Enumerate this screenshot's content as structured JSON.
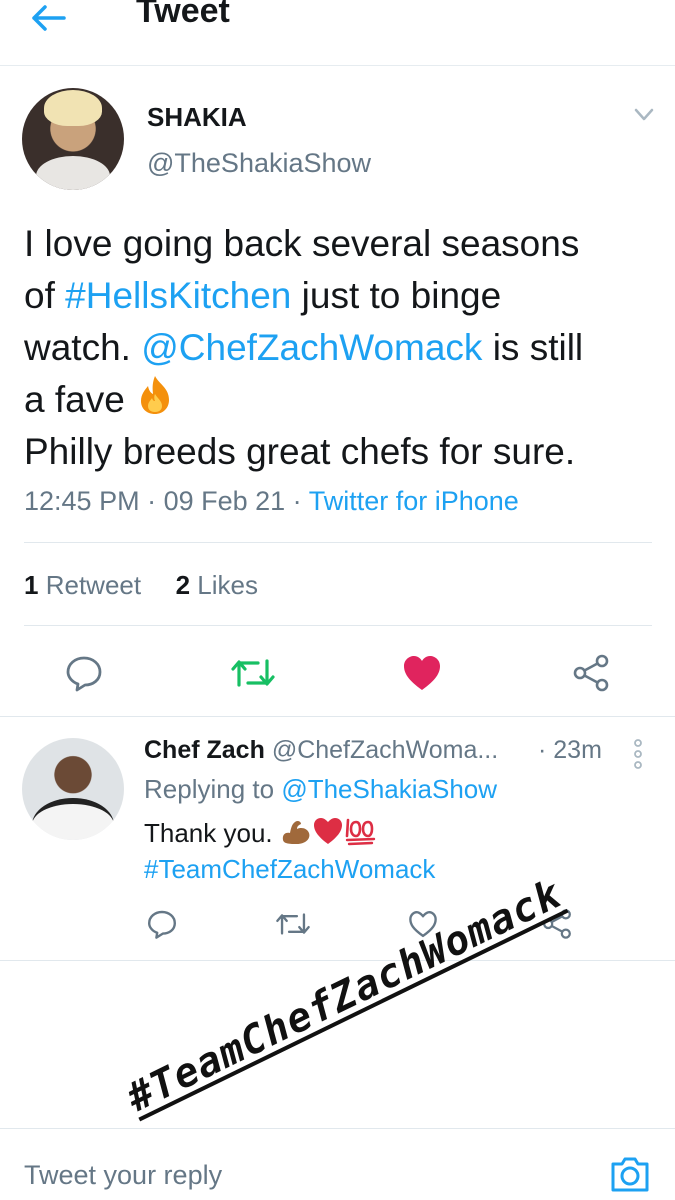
{
  "header": {
    "title": "Tweet",
    "back_icon": "arrow-left-icon"
  },
  "tweet": {
    "author_name": "SHAKIA",
    "author_handle": "@TheShakiaShow",
    "text_line1": "I love going back several seasons",
    "text_of": "of ",
    "hashtag": "#HellsKitchen",
    "text_mid": " just to binge",
    "text_watch": "watch. ",
    "mention": "@ChefZachWomack",
    "text_still": " is still",
    "text_fave": "a fave ",
    "text_last": "Philly breeds great chefs for sure.",
    "time": "12:45 PM",
    "sep1": " · ",
    "date": "09 Feb 21",
    "sep2": " · ",
    "source": "Twitter for iPhone",
    "retweet_count": "1",
    "retweet_label": "Retweet",
    "like_count": "2",
    "like_label": "Likes"
  },
  "reply": {
    "author_name": "Chef Zach",
    "author_handle": "@ChefZachWoma...",
    "time": "· 23m",
    "replying_label": "Replying to ",
    "replying_handle": "@TheShakiaShow",
    "text": "Thank you. ",
    "hashtag": "#TeamChefZachWomack"
  },
  "overlay": {
    "text": "#TeamChefZachWomack"
  },
  "compose": {
    "placeholder": "Tweet your reply"
  },
  "colors": {
    "accent": "#1da1f2",
    "retweet": "#17bf63",
    "like": "#e0245e",
    "muted": "#657786"
  }
}
